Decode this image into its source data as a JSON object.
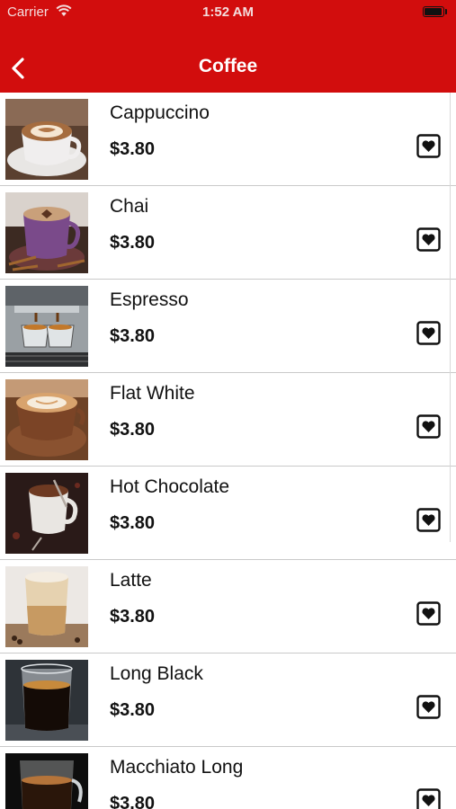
{
  "status_bar": {
    "carrier": "Carrier",
    "time": "1:52 AM"
  },
  "nav": {
    "title": "Coffee",
    "back_icon": "chevron-left-icon"
  },
  "colors": {
    "header": "#d20d0d",
    "text": "#111111",
    "divider": "#c9c9c9"
  },
  "items": [
    {
      "name": "Cappuccino",
      "price": "$3.80",
      "image": "cappuccino-photo"
    },
    {
      "name": "Chai",
      "price": "$3.80",
      "image": "chai-photo"
    },
    {
      "name": "Espresso",
      "price": "$3.80",
      "image": "espresso-photo"
    },
    {
      "name": "Flat White",
      "price": "$3.80",
      "image": "flat-white-photo"
    },
    {
      "name": "Hot Chocolate",
      "price": "$3.80",
      "image": "hot-chocolate-photo"
    },
    {
      "name": "Latte",
      "price": "$3.80",
      "image": "latte-photo"
    },
    {
      "name": "Long Black",
      "price": "$3.80",
      "image": "long-black-photo"
    },
    {
      "name": "Macchiato Long",
      "price": "$3.80",
      "image": "macchiato-long-photo"
    }
  ]
}
